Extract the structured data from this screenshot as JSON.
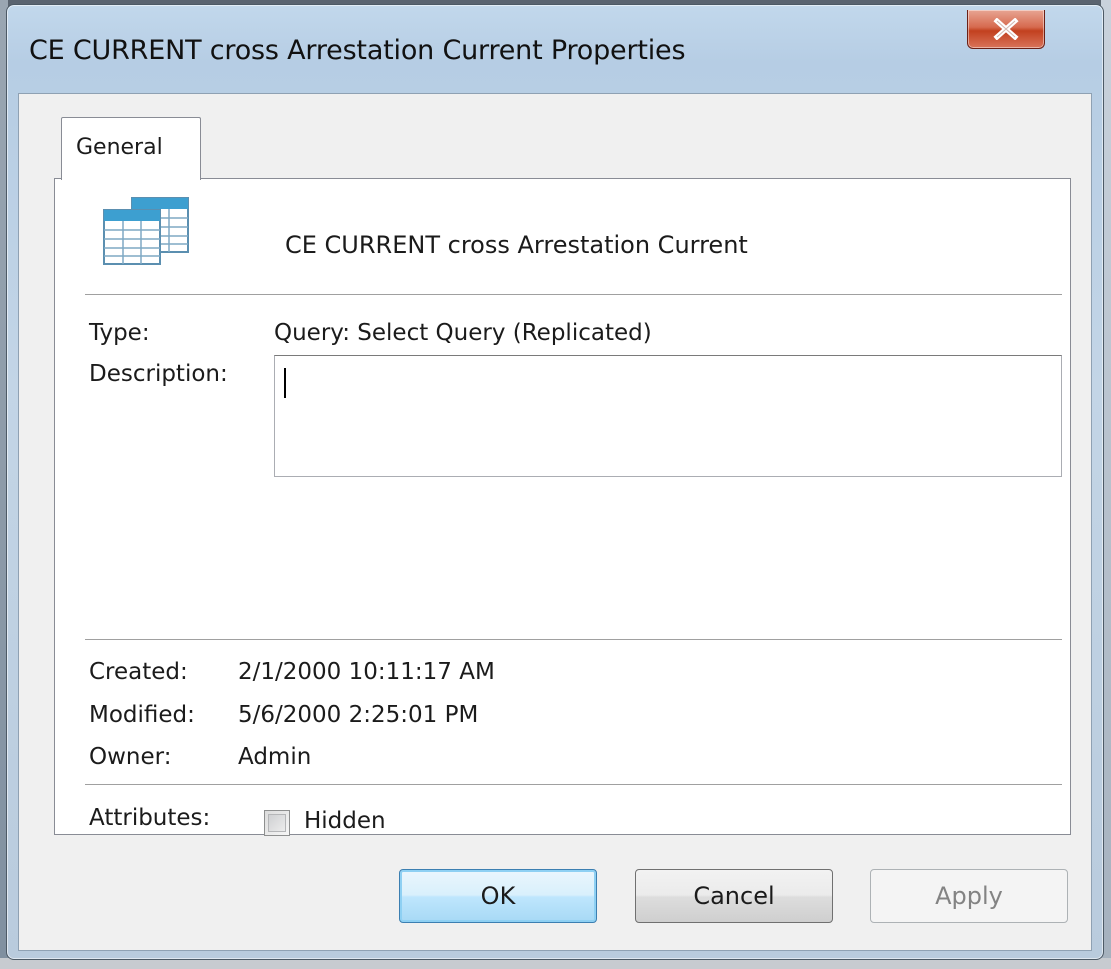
{
  "window": {
    "title": "CE CURRENT cross Arrestation Current Properties",
    "close_icon": "close-icon"
  },
  "tabs": [
    {
      "label": "General",
      "selected": true
    }
  ],
  "general": {
    "icon": "query-table-icon",
    "object_name": "CE CURRENT cross Arrestation Current",
    "type_label": "Type:",
    "type_value": "Query: Select Query (Replicated)",
    "description_label": "Description:",
    "description_value": "",
    "created_label": "Created:",
    "created_value": "2/1/2000 10:11:17 AM",
    "modified_label": "Modified:",
    "modified_value": "5/6/2000 2:25:01 PM",
    "owner_label": "Owner:",
    "owner_value": "Admin",
    "attributes_label": "Attributes:",
    "hidden_label": "Hidden",
    "hidden_checked": false
  },
  "buttons": {
    "ok": "OK",
    "cancel": "Cancel",
    "apply": "Apply",
    "apply_enabled": false
  },
  "colors": {
    "close_button": "#c2401f",
    "default_button_border": "#3c7fb1"
  }
}
